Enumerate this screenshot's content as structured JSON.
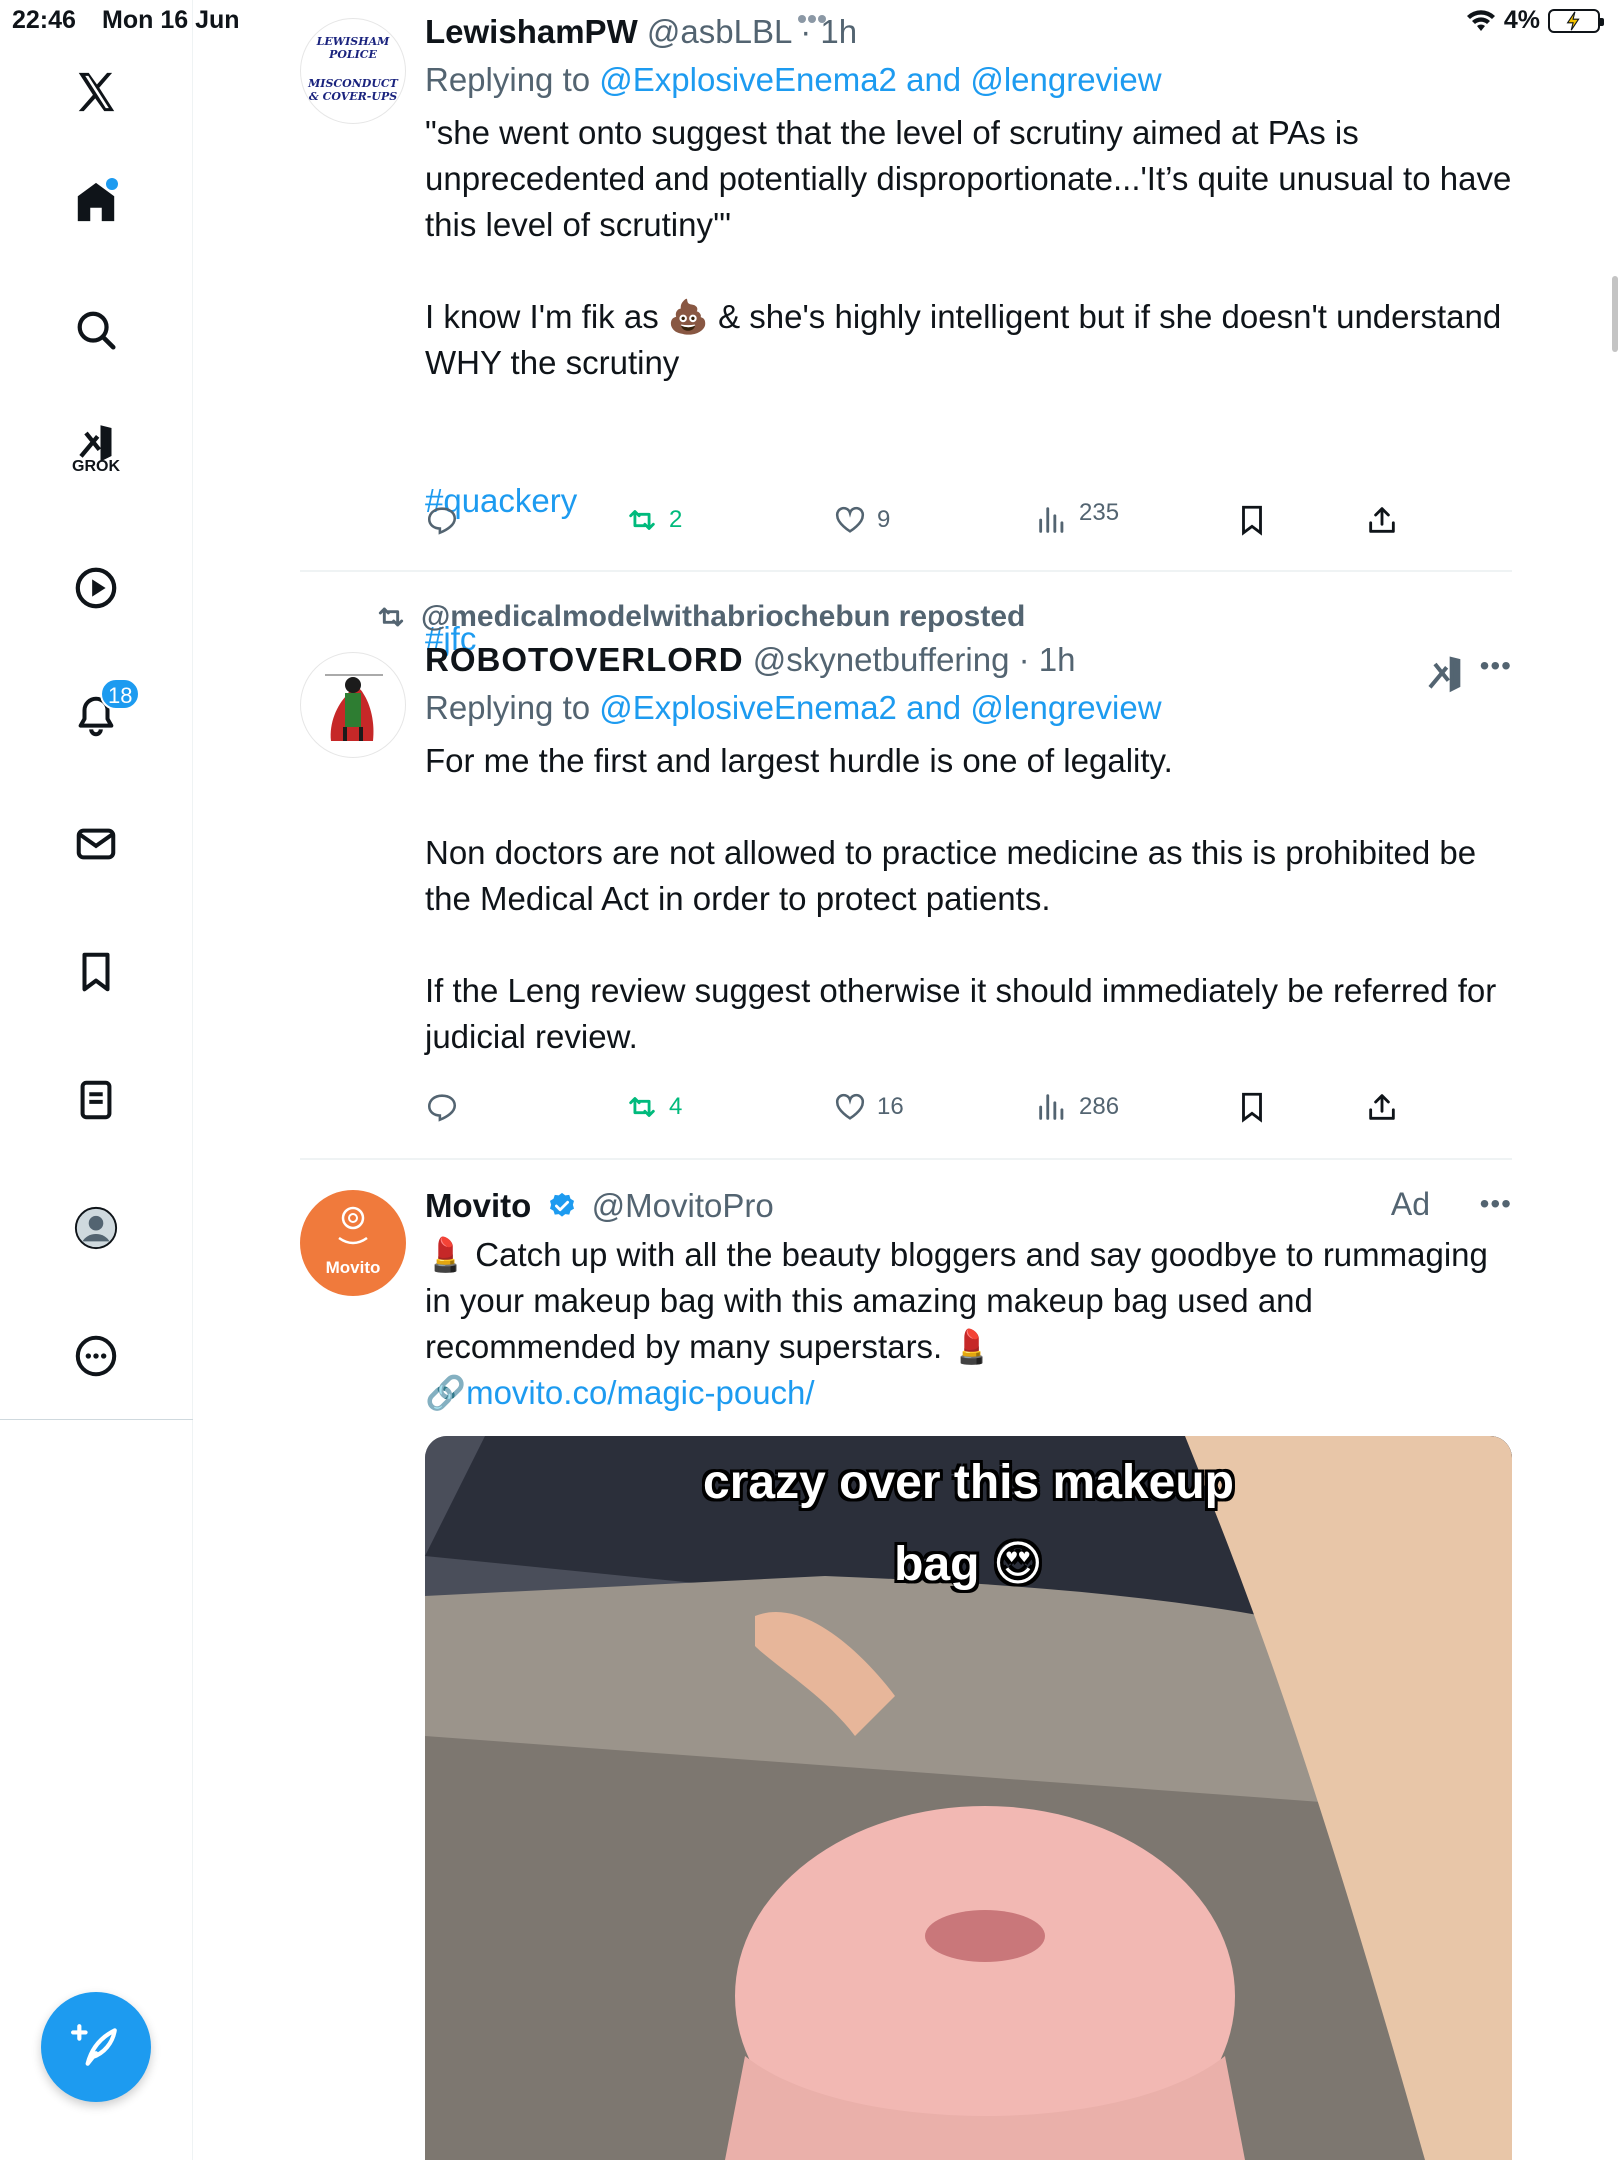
{
  "status_bar": {
    "time": "22:46",
    "date": "Mon 16 Jun",
    "battery": "4%"
  },
  "sidebar": {
    "items": [
      {
        "name": "x-logo"
      },
      {
        "name": "home",
        "has_dot": true
      },
      {
        "name": "explore"
      },
      {
        "name": "grok",
        "label": "GROK"
      },
      {
        "name": "video"
      },
      {
        "name": "notifications",
        "badge": "18"
      },
      {
        "name": "messages"
      },
      {
        "name": "bookmarks"
      },
      {
        "name": "lists"
      },
      {
        "name": "profile"
      },
      {
        "name": "more"
      }
    ],
    "accent_color": "#1d9bf0"
  },
  "tweets": [
    {
      "display_name": "LewishamPW",
      "handle": "@asbLBL",
      "time": "· 1h",
      "avatar_text": [
        "LEWISHAM",
        "POLICE",
        "MISCONDUCT",
        "& COVER-UPS"
      ],
      "replying_prefix": "Replying to ",
      "reply_mention_1": "@ExplosiveEnema2",
      "reply_and": " and ",
      "reply_mention_2": "@lengreview",
      "text_1": "\"she went onto suggest that the level of scrutiny aimed at PAs is unprecedented and potentially disproportionate...'It’s quite unusual to have this level of scrutiny'\"",
      "text_2": "I know I'm fik as 💩 & she's highly intelligent but if she doesn't understand WHY the scrutiny",
      "hashtags": [
        "#quackery",
        "#jfc"
      ],
      "reposts": "2",
      "likes": "9",
      "views": "235"
    },
    {
      "repost_by": "@medicalmodelwithabriochebun reposted",
      "display_name": "ROBOTOVERLORD",
      "handle": "@skynetbuffering",
      "time": "· 1h",
      "replying_prefix": "Replying to ",
      "reply_mention_1": "@ExplosiveEnema2",
      "reply_and": " and ",
      "reply_mention_2": "@lengreview",
      "text_1": "For me the first and largest hurdle is one of legality.",
      "text_2": "Non doctors are not allowed to practice medicine as this is prohibited be the Medical Act in order to protect patients.",
      "text_3": "If the Leng review suggest otherwise it should immediately be referred for judicial review.",
      "reposts": "4",
      "likes": "16",
      "views": "286"
    },
    {
      "display_name": "Movito",
      "handle": "@MovitoPro",
      "ad_label": "Ad",
      "avatar_text": "Movito",
      "text_1": "💄 Catch up with all the beauty bloggers and say goodbye to rummaging in your makeup bag with this amazing makeup bag used and recommended by many superstars. 💄",
      "link_emoji": "🔗",
      "link": "movito.co/magic-pouch/",
      "media_caption_1": "crazy over this makeup",
      "media_caption_2": "bag 😍"
    }
  ]
}
